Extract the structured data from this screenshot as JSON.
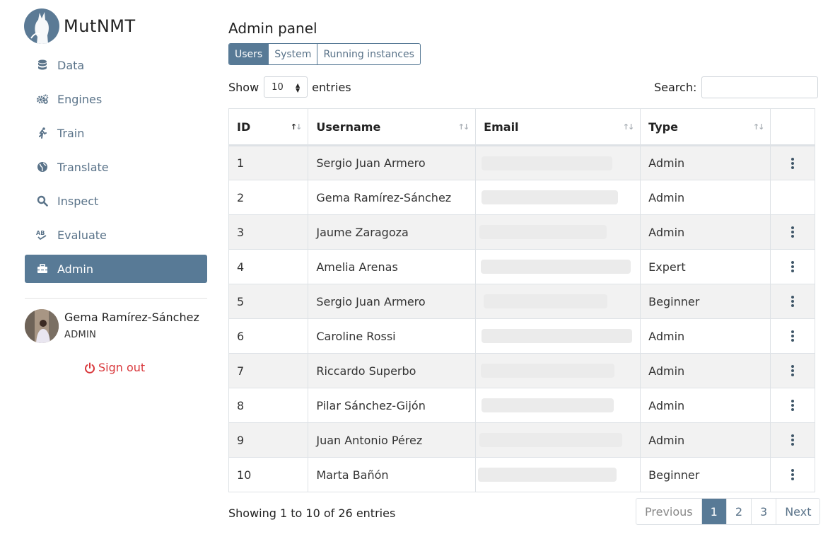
{
  "app": {
    "name": "MutNMT"
  },
  "nav": {
    "items": [
      {
        "label": "Data",
        "icon": "database-icon"
      },
      {
        "label": "Engines",
        "icon": "gears-icon"
      },
      {
        "label": "Train",
        "icon": "running-icon"
      },
      {
        "label": "Translate",
        "icon": "globe-icon"
      },
      {
        "label": "Inspect",
        "icon": "search-icon"
      },
      {
        "label": "Evaluate",
        "icon": "spellcheck-icon"
      },
      {
        "label": "Admin",
        "icon": "toolbox-icon",
        "active": true
      }
    ]
  },
  "user": {
    "name": "Gema Ramírez-Sánchez",
    "role": "ADMIN"
  },
  "signout": {
    "label": "Sign out"
  },
  "page": {
    "title": "Admin panel"
  },
  "tabs": [
    {
      "label": "Users",
      "active": true
    },
    {
      "label": "System"
    },
    {
      "label": "Running instances"
    }
  ],
  "table_controls": {
    "show_label": "Show",
    "entries_value": "10",
    "entries_label": "entries",
    "search_label": "Search:",
    "search_value": ""
  },
  "table": {
    "columns": [
      "ID",
      "Username",
      "Email",
      "Type"
    ],
    "rows": [
      {
        "id": "1",
        "username": "Sergio Juan Armero",
        "type": "Admin",
        "actions": true
      },
      {
        "id": "2",
        "username": "Gema Ramírez-Sánchez",
        "type": "Admin",
        "actions": false
      },
      {
        "id": "3",
        "username": "Jaume Zaragoza",
        "type": "Admin",
        "actions": true
      },
      {
        "id": "4",
        "username": "Amelia Arenas",
        "type": "Expert",
        "actions": true
      },
      {
        "id": "5",
        "username": "Sergio Juan Armero",
        "type": "Beginner",
        "actions": true
      },
      {
        "id": "6",
        "username": "Caroline Rossi",
        "type": "Admin",
        "actions": true
      },
      {
        "id": "7",
        "username": "Riccardo Superbo",
        "type": "Admin",
        "actions": true
      },
      {
        "id": "8",
        "username": "Pilar Sánchez-Gijón",
        "type": "Admin",
        "actions": true
      },
      {
        "id": "9",
        "username": "Juan Antonio Pérez",
        "type": "Admin",
        "actions": true
      },
      {
        "id": "10",
        "username": "Marta Bañón",
        "type": "Beginner",
        "actions": true
      }
    ]
  },
  "footer": {
    "info": "Showing 1 to 10 of 26 entries",
    "pagination": [
      "Previous",
      "1",
      "2",
      "3",
      "Next"
    ],
    "active_page": "1"
  },
  "colors": {
    "accent": "#587a96",
    "signout": "#d9373b"
  }
}
